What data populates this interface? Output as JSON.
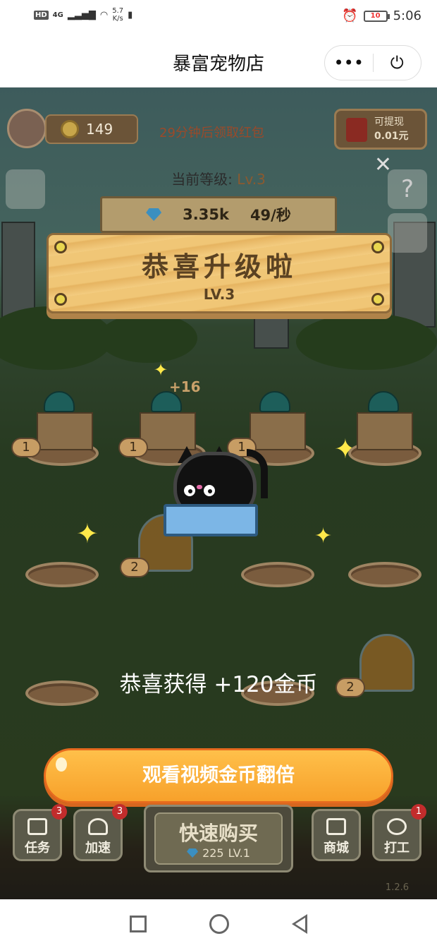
{
  "status_bar": {
    "network_badge": "HD",
    "network_gen": "4G",
    "speed_value": "5.7",
    "speed_unit": "K/s",
    "battery": "10",
    "time": "5:06"
  },
  "titlebar": {
    "title": "暴富宠物店",
    "more_icon": "more-dots-icon",
    "power_icon": "power-icon"
  },
  "hud": {
    "coins": "149",
    "redpack_tip": "29分钟后领取红包",
    "withdraw_label": "可提现",
    "withdraw_amount": "0.01元",
    "level_label": "当前等级:",
    "level_value": "Lv.3",
    "gems": "3.35k",
    "rate": "49/秒"
  },
  "popup": {
    "title": "恭喜升级啦",
    "level": "LV.3",
    "floating_bonus": "+16",
    "reward_text": "恭喜获得 +120金币",
    "cta": "观看视频金币翻倍"
  },
  "grid_tags": [
    "1",
    "1",
    "1",
    "2",
    "2"
  ],
  "bottom_nav": {
    "task_label": "任务",
    "task_badge": "3",
    "speed_label": "加速",
    "speed_badge": "3",
    "quickbuy_label": "快速购买",
    "quickbuy_cost": "225",
    "quickbuy_level": "LV.1",
    "shop_label": "商城",
    "work_label": "打工",
    "work_badge": "1"
  },
  "version": "1.2.6",
  "colors": {
    "cta_orange": "#f7a12b",
    "cta_border": "#e66a1e",
    "banner_wood": "#f0c676",
    "level_brown": "#8a5a30"
  }
}
